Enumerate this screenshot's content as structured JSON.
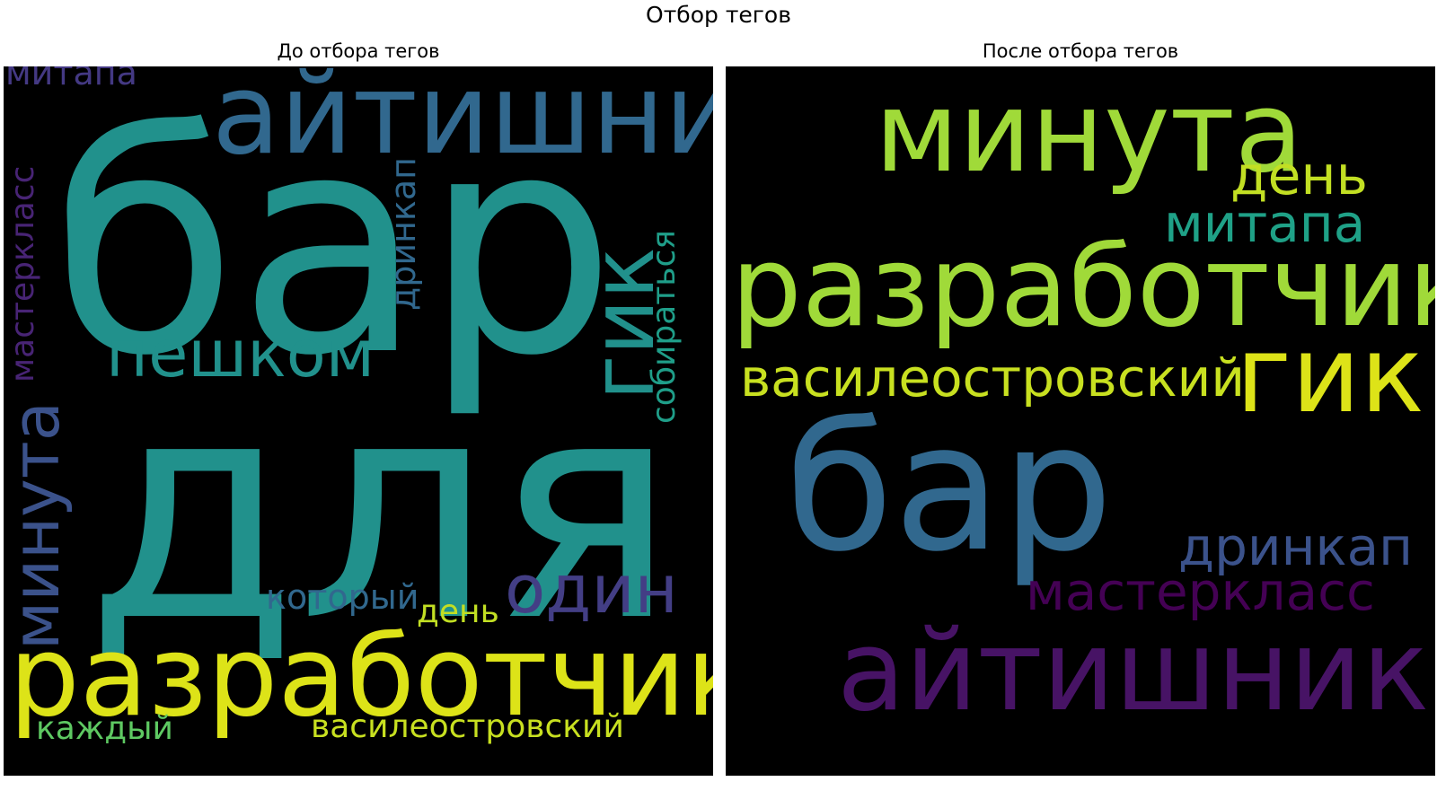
{
  "figure": {
    "title": "Отбор тегов"
  },
  "panels": [
    {
      "title": "До отбора тегов",
      "words": [
        {
          "text": "бар",
          "color": "#21918c"
        },
        {
          "text": "для",
          "color": "#21918c"
        },
        {
          "text": "айтишник",
          "color": "#31688e"
        },
        {
          "text": "разработчик",
          "color": "#dde318"
        },
        {
          "text": "минута",
          "color": "#3b528b"
        },
        {
          "text": "гик",
          "color": "#21918c"
        },
        {
          "text": "пешком",
          "color": "#21918c"
        },
        {
          "text": "один",
          "color": "#433e85"
        },
        {
          "text": "митапа",
          "color": "#443983"
        },
        {
          "text": "мастеркласс",
          "color": "#482475"
        },
        {
          "text": "дринкап",
          "color": "#31688e"
        },
        {
          "text": "собираться",
          "color": "#1f9e89"
        },
        {
          "text": "который",
          "color": "#31688e"
        },
        {
          "text": "день",
          "color": "#c2df23"
        },
        {
          "text": "каждый",
          "color": "#5ec962"
        },
        {
          "text": "василеостровский",
          "color": "#c8e020"
        }
      ]
    },
    {
      "title": "После отбора тегов",
      "words": [
        {
          "text": "минута",
          "color": "#a0da39"
        },
        {
          "text": "день",
          "color": "#c2df23"
        },
        {
          "text": "митапа",
          "color": "#1fa187"
        },
        {
          "text": "разработчик",
          "color": "#a0da39"
        },
        {
          "text": "василеостровский",
          "color": "#c8e020"
        },
        {
          "text": "гик",
          "color": "#dde318"
        },
        {
          "text": "бар",
          "color": "#31688e"
        },
        {
          "text": "дринкап",
          "color": "#3b528b"
        },
        {
          "text": "мастеркласс",
          "color": "#440154"
        },
        {
          "text": "айтишник",
          "color": "#471365"
        }
      ]
    }
  ]
}
